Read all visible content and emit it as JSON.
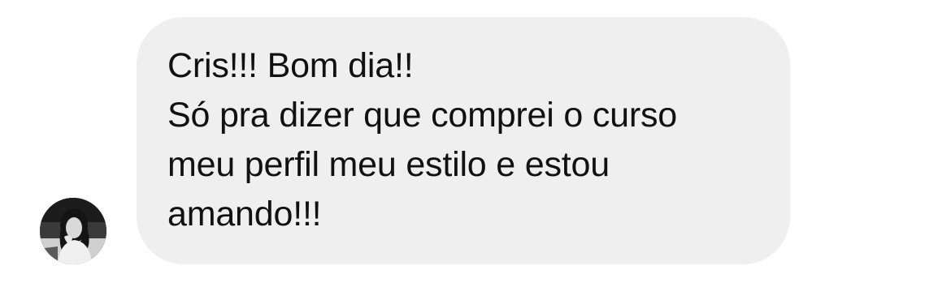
{
  "message": {
    "sender_avatar_icon": "profile-photo-avatar-icon",
    "lines": [
      "Cris!!! Bom dia!!",
      "Só pra dizer que comprei o curso",
      "meu perfil meu estilo e estou",
      "amando!!!"
    ]
  },
  "colors": {
    "background": "#ffffff",
    "bubble": "#efefef",
    "text": "#111111"
  }
}
